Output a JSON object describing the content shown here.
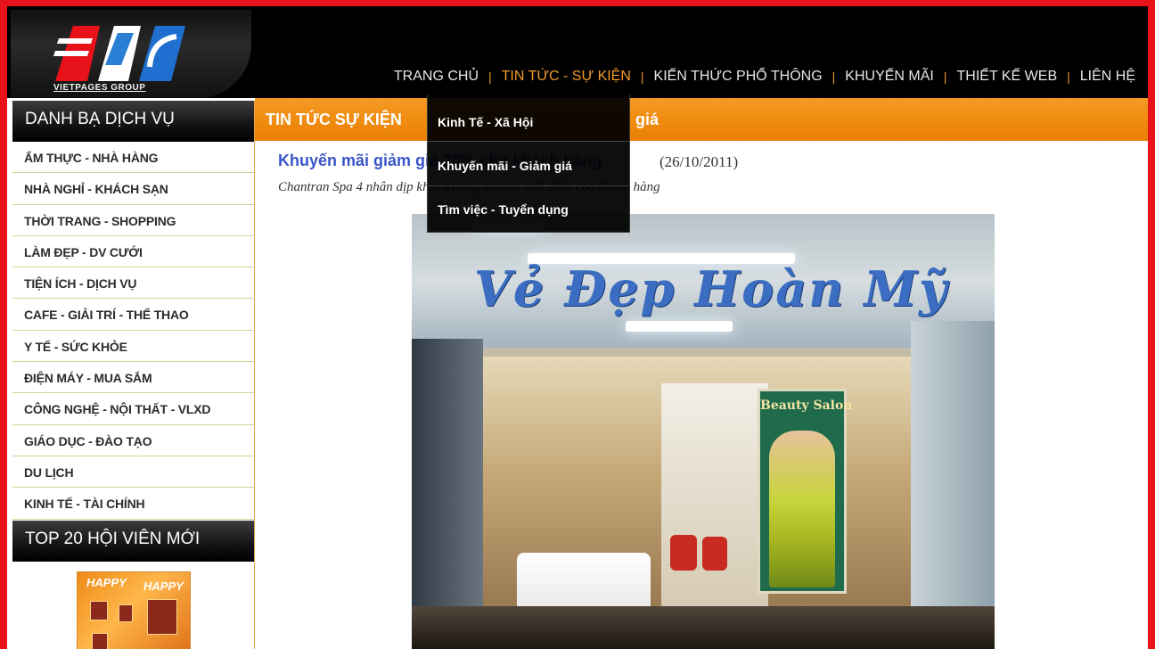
{
  "logo": {
    "text": "VIETPAGES GROUP"
  },
  "nav": {
    "items": [
      {
        "label": "TRANG CHỦ",
        "active": false
      },
      {
        "label": "TIN TỨC - SỰ KIỆN",
        "active": true
      },
      {
        "label": "KIẾN THỨC PHỔ THÔNG",
        "active": false
      },
      {
        "label": "KHUYẾN MÃI",
        "active": false
      },
      {
        "label": "THIẾT KẾ WEB",
        "active": false
      },
      {
        "label": "LIÊN HỆ",
        "active": false
      }
    ],
    "separator": "|"
  },
  "dropdown": {
    "items": [
      "Kinh Tế - Xã Hội",
      "Khuyến mãi - Giảm giá",
      "Tìm việc - Tuyển dụng"
    ]
  },
  "sidebar": {
    "heading": "DANH BẠ DỊCH VỤ",
    "categories": [
      "ẨM THỰC - NHÀ HÀNG",
      "NHÀ NGHỈ - KHÁCH SẠN",
      "THỜI TRANG - SHOPPING",
      "LÀM ĐẸP - DV CƯỚI",
      "TIỆN ÍCH - DỊCH VỤ",
      "CAFE - GIẢI TRÍ - THỂ THAO",
      "Y TẾ - SỨC KHỎE",
      "ĐIỆN MÁY - MUA SẮM",
      "CÔNG NGHỆ - NỘI THẤT - VLXD",
      "GIÁO DỤC - ĐÀO TẠO",
      "DU LỊCH",
      "KINH TẾ - TÀI CHÍNH"
    ],
    "top20_heading": "TOP 20 HỘI VIÊN MỚI",
    "thumb_words": [
      "HAPPY",
      "HAPPY"
    ]
  },
  "main": {
    "bar_title": "TIN TỨC SỰ KIỆN",
    "bar_tail": "giá",
    "article": {
      "title": "Khuyến mãi giảm giá 20% cho khách hàng",
      "date": "(26/10/2011)",
      "summary": "Chantran Spa 4 nhân dịp khai trương khuyến mãi 20% cho khách hàng"
    },
    "photo": {
      "sign_text": "Vẻ Đẹp Hoàn Mỹ",
      "board_text": "Beauty Salon"
    }
  },
  "colors": {
    "frame": "#e8121b",
    "accent_orange": "#f19b26",
    "link_blue": "#3a55c7",
    "header_bg": "#000000"
  }
}
